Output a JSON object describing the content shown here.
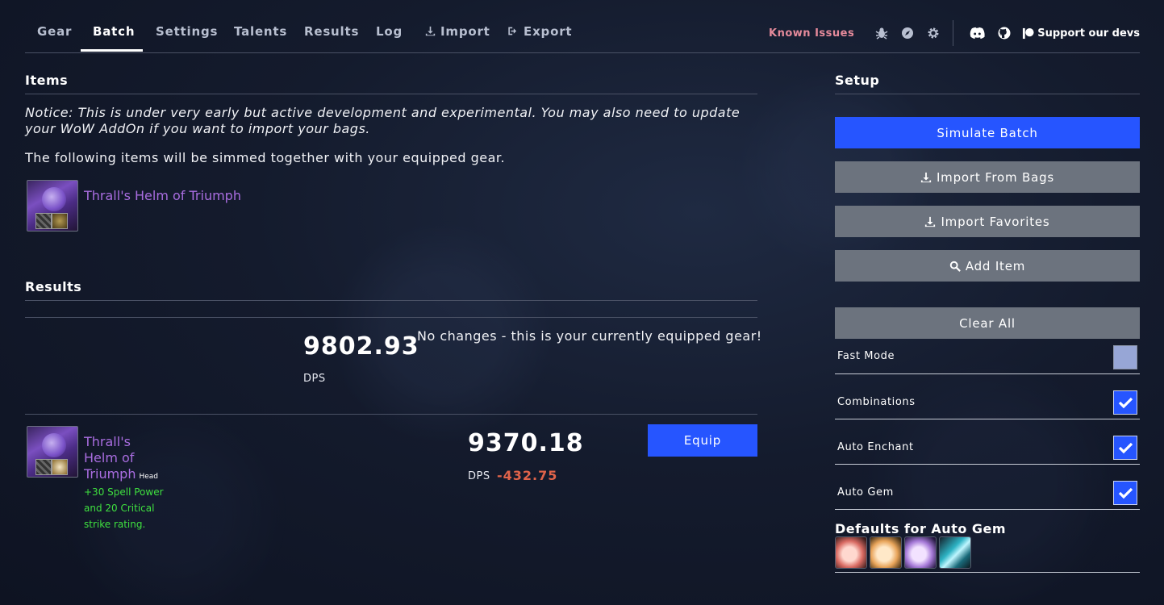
{
  "nav": {
    "tabs": [
      {
        "label": "Gear"
      },
      {
        "label": "Batch"
      },
      {
        "label": "Settings"
      },
      {
        "label": "Talents"
      },
      {
        "label": "Results"
      },
      {
        "label": "Log"
      },
      {
        "label": "Import"
      },
      {
        "label": "Export"
      }
    ],
    "active_tab": "Batch",
    "known_issues": "Known Issues",
    "support": "Support our devs",
    "icons": [
      "bug-icon",
      "compass-icon",
      "gear-icon",
      "discord-icon",
      "github-icon",
      "patreon-icon"
    ]
  },
  "items": {
    "heading": "Items",
    "notice": "Notice: This is under very early but active development and experimental. You may also need to update your WoW AddOn if you want to import your bags.",
    "description": "The following items will be simmed together with your equipped gear.",
    "list": [
      {
        "name": "Thrall's Helm of Triumph"
      }
    ]
  },
  "results": {
    "heading": "Results",
    "baseline": {
      "dps": "9802.93",
      "dps_label": "DPS",
      "message": "No changes - this is your currently equipped gear!"
    },
    "rows": [
      {
        "item_line1": "Thrall's",
        "item_line2": "Helm of",
        "item_line3": "Triumph",
        "slot": "Head",
        "bonus": "+30 Spell Power and 20 Critical strike rating.",
        "dps": "9370.18",
        "dps_label": "DPS",
        "delta": "-432.75",
        "equip_label": "Equip"
      }
    ]
  },
  "setup": {
    "heading": "Setup",
    "simulate": "Simulate Batch",
    "import_bags": "Import From Bags",
    "import_favorites": "Import Favorites",
    "add_item": "Add Item",
    "clear_all": "Clear All",
    "options": [
      {
        "label": "Fast Mode",
        "checked": false
      },
      {
        "label": "Combinations",
        "checked": true
      },
      {
        "label": "Auto Enchant",
        "checked": true
      },
      {
        "label": "Auto Gem",
        "checked": true
      }
    ],
    "gems_heading": "Defaults for Auto Gem",
    "gems": [
      "red-gem-icon",
      "orange-gem-icon",
      "purple-gem-icon",
      "meta-gem-icon"
    ]
  },
  "colors": {
    "primary": "#2655ff",
    "secondary": "#6c737e",
    "epic": "#a96de0",
    "bonus": "#3fe03f",
    "negative": "#e0634a",
    "known_issues": "#e58a9b"
  }
}
